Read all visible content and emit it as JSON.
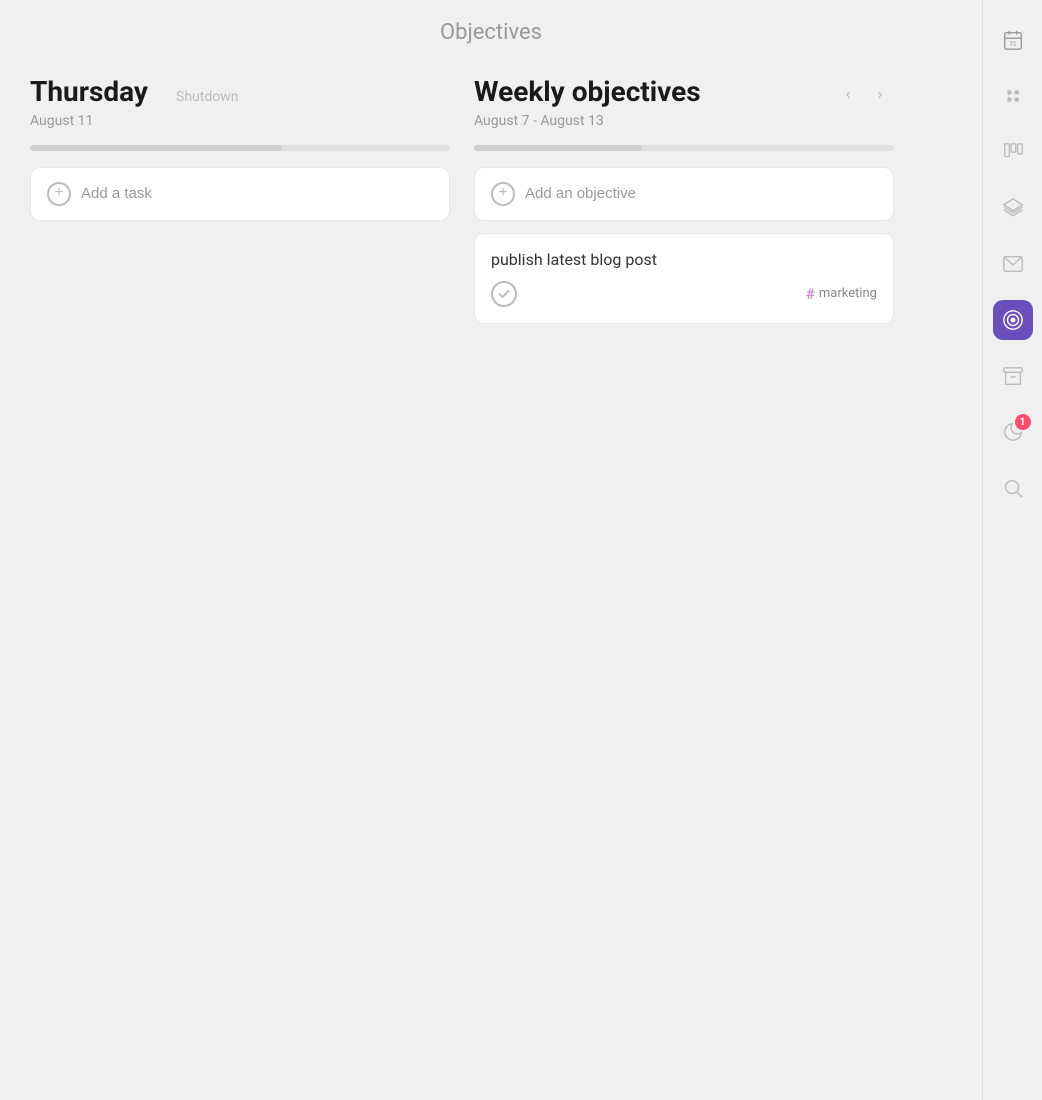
{
  "page": {
    "title": "Objectives"
  },
  "left_column": {
    "day": "Thursday",
    "date": "August 11",
    "badge": "Shutdown",
    "progress": 60,
    "add_label": "Add a task"
  },
  "right_column": {
    "title": "Weekly objectives",
    "date_range": "August 7 - August 13",
    "progress": 40,
    "add_label": "Add an objective",
    "objectives": [
      {
        "title": "publish latest blog post",
        "tag": "marketing"
      }
    ]
  },
  "sidebar": {
    "icons": [
      {
        "name": "calendar-icon",
        "label": "Calendar",
        "active": false
      },
      {
        "name": "dots-icon",
        "label": "Dashboard",
        "active": false
      },
      {
        "name": "board-icon",
        "label": "Board",
        "active": false
      },
      {
        "name": "layers-icon",
        "label": "Layers",
        "active": false
      },
      {
        "name": "mail-icon",
        "label": "Mail",
        "active": false
      },
      {
        "name": "objectives-icon",
        "label": "Objectives",
        "active": true
      },
      {
        "name": "archive-icon",
        "label": "Archive",
        "active": false
      },
      {
        "name": "moon-icon",
        "label": "Sleep",
        "active": false,
        "badge": 1
      },
      {
        "name": "search-icon",
        "label": "Search",
        "active": false
      }
    ]
  }
}
